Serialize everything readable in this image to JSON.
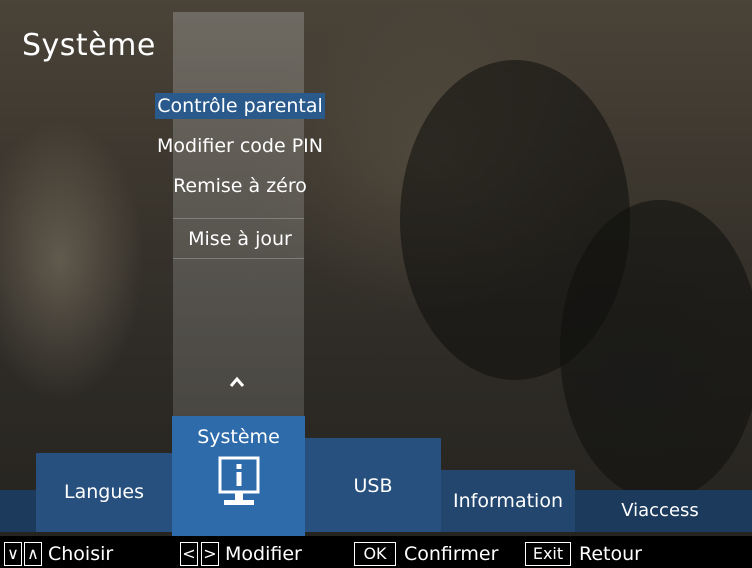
{
  "screen": {
    "title": "Système"
  },
  "menu": {
    "items": [
      {
        "label": "Contrôle parental",
        "selected": true
      },
      {
        "label": "Modifier code PIN",
        "selected": false
      },
      {
        "label": "Remise à zéro",
        "selected": false
      },
      {
        "label": "Mise à jour",
        "selected": false
      }
    ],
    "scroll_icon": "chevron-up-icon"
  },
  "tabs": [
    {
      "label": "Langues",
      "active": false
    },
    {
      "label": "Système",
      "active": true,
      "icon": "monitor-info-icon"
    },
    {
      "label": "USB",
      "active": false
    },
    {
      "label": "Information",
      "active": false
    },
    {
      "label": "Viaccess",
      "active": false
    }
  ],
  "footer": {
    "navigate": {
      "keys": [
        "∨",
        "∧"
      ],
      "label": "Choisir"
    },
    "modify": {
      "keys": [
        "<",
        ">"
      ],
      "label": "Modifier"
    },
    "confirm": {
      "key": "OK",
      "label": "Confirmer"
    },
    "back": {
      "key": "Exit",
      "label": "Retour"
    }
  },
  "colors": {
    "selected_item": "#2a5a8c",
    "active_tab": "#2d6bab",
    "tab": "#27507e",
    "tab_bar": "#1b3a5c",
    "footer": "#000000"
  }
}
